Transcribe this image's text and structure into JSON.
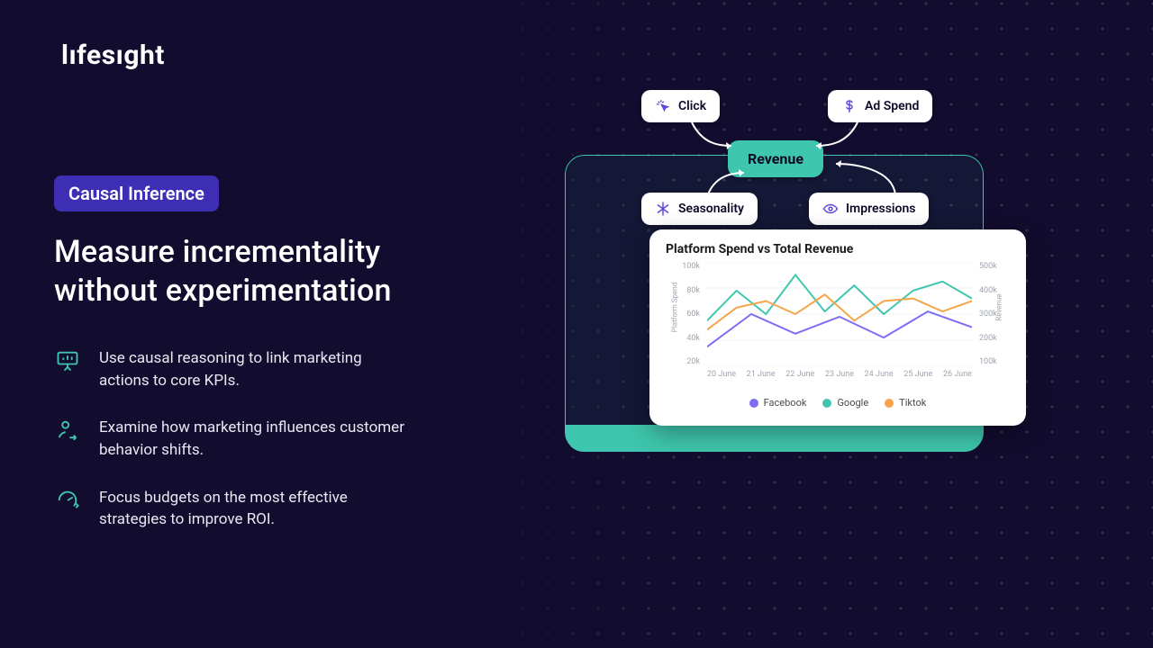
{
  "brand": {
    "name": "lıfesıght"
  },
  "badge": "Causal Inference",
  "headline_l1": "Measure incrementality",
  "headline_l2": "without experimentation",
  "bullets": [
    "Use causal reasoning to link marketing actions to core KPIs.",
    "Examine how marketing influences customer behavior shifts.",
    "Focus budgets on the most effective strategies to improve ROI."
  ],
  "nodes": {
    "click": "Click",
    "adspend": "Ad Spend",
    "revenue": "Revenue",
    "seasonality": "Seasonality",
    "impressions": "Impressions"
  },
  "chart_title": "Platform Spend vs Total Revenue",
  "axis": {
    "left_label": "Platform Spend",
    "right_label": "Revenue",
    "left_ticks": [
      "100k",
      "80k",
      "60k",
      "40k",
      "20k"
    ],
    "right_ticks": [
      "500k",
      "400k",
      "300k",
      "200k",
      "100k"
    ],
    "x_ticks": [
      "20 June",
      "21 June",
      "22 June",
      "23 June",
      "24 June",
      "25 June",
      "26 June"
    ]
  },
  "legend": {
    "facebook": "Facebook",
    "google": "Google",
    "tiktok": "Tiktok"
  },
  "chart_data": {
    "type": "line",
    "title": "Platform Spend vs Total Revenue",
    "categories": [
      "20 June",
      "21 June",
      "22 June",
      "23 June",
      "24 June",
      "25 June",
      "26 June"
    ],
    "xlabel": "",
    "y_left": {
      "label": "Platform Spend",
      "lim": [
        20,
        100
      ],
      "unit": "k"
    },
    "y_right": {
      "label": "Revenue",
      "lim": [
        100,
        500
      ],
      "unit": "k"
    },
    "series": [
      {
        "name": "Facebook",
        "color": "#7C6CF6",
        "values": [
          35,
          60,
          45,
          58,
          42,
          62,
          50
        ]
      },
      {
        "name": "Google",
        "color": "#3FC6AE",
        "values": [
          55,
          78,
          60,
          90,
          62,
          82,
          60,
          78,
          85,
          72
        ]
      },
      {
        "name": "Tiktok",
        "color": "#F6A54A",
        "values": [
          48,
          65,
          70,
          60,
          75,
          55,
          70,
          72,
          62,
          70
        ]
      }
    ],
    "note": "Google and Tiktok series show ~10 sample points across the window; Facebook shows ~7. Values are Platform Spend in k read from left axis."
  },
  "colors": {
    "facebook": "#7C6CF6",
    "google": "#3FC6AE",
    "tiktok": "#F6A54A",
    "badge_bg": "#3E2EB3",
    "accent": "#3FC6AE",
    "bg": "#120C2E"
  }
}
